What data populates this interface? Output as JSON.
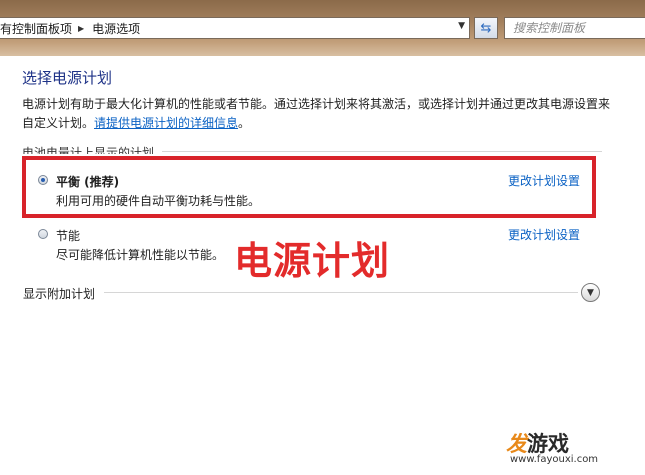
{
  "address_bar": {
    "breadcrumbs": [
      "有控制面板项",
      "电源选项"
    ],
    "search_placeholder": "搜索控制面板"
  },
  "main": {
    "title": "选择电源计划",
    "description": "电源计划有助于最大化计算机的性能或者节能。通过选择计划来将其激活，或选择计划并通过更改其电源设置来自定义计划。",
    "description_link": "请提供电源计划的详细信息",
    "description_end": "。",
    "section_label": "电池电量计上显示的计划",
    "plans": [
      {
        "name": "平衡 (推荐)",
        "description": "利用可用的硬件自动平衡功耗与性能。",
        "link": "更改计划设置",
        "selected": true
      },
      {
        "name": "节能",
        "description": "尽可能降低计算机性能以节能。",
        "link": "更改计划设置",
        "selected": false
      }
    ],
    "more_plans_label": "显示附加计划"
  },
  "annotation": {
    "text": "电源计划",
    "color": "#e32b2b"
  },
  "watermark": {
    "brand_accent": "发",
    "brand_rest": "游戏",
    "url": "www.fayouxi.com"
  },
  "icons": {
    "refresh": "refresh-icon",
    "expand": "chevron-down-icon",
    "crumb_sep": "triangle-right-icon"
  }
}
